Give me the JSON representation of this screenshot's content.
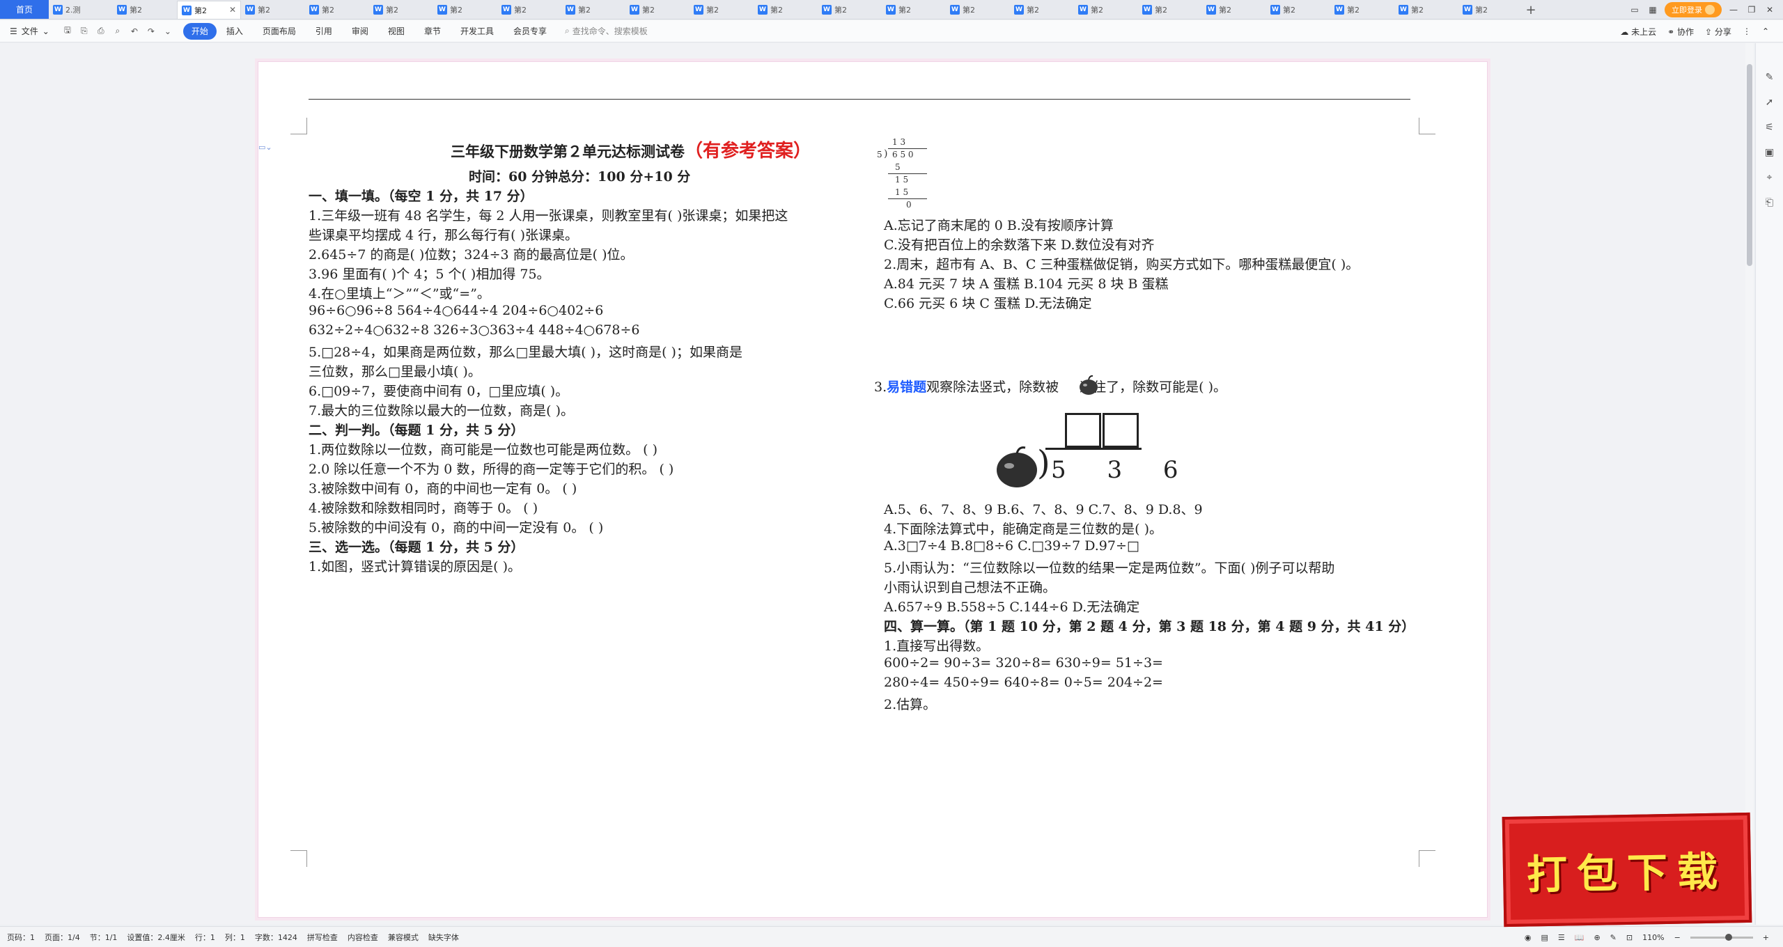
{
  "tabs": {
    "home": "首页",
    "docs": [
      "2.测",
      "第2",
      "第2",
      "第2",
      "第2",
      "第2",
      "第2",
      "第2",
      "第2",
      "第2",
      "第2",
      "第2",
      "第2",
      "第2",
      "第2",
      "第2",
      "第2",
      "第2",
      "第2",
      "第2",
      "第2",
      "第2",
      "第2"
    ],
    "active_index": 2,
    "login": "立即登录",
    "plus": "+"
  },
  "toolbar": {
    "file": "文件",
    "menus": [
      "开始",
      "插入",
      "页面布局",
      "引用",
      "审阅",
      "视图",
      "章节",
      "开发工具",
      "会员专享"
    ],
    "search_placeholder": "查找命令、搜索模板",
    "cloud": "未上云",
    "collab": "协作",
    "share": "分享"
  },
  "document": {
    "title_main": "三年级下册数学第２单元达标测试卷",
    "title_red": "（有参考答案）",
    "subtitle": "时间：60 分钟总分：100 分+10 分",
    "left_lines": [
      "一、填一填。（每空 1 分，共 17 分）",
      "1.三年级一班有 48 名学生，每 2 人用一张课桌，则教室里有(          )张课桌；如果把这",
      "些课桌平均摆成 4 行，那么每行有(          )张课桌。",
      "2.645÷7 的商是(          )位数；324÷3 商的最高位是(            )位。",
      "3.96 里面有(          )个 4；5 个(          )相加得 75。",
      "4.在○里填上“＞”“＜”或“=”。",
      "96÷6○96÷8                   564÷4○644÷4                  204÷6○402÷6",
      "632÷2÷4○632÷8             326÷3○363÷4                  448÷4○678÷6",
      "5.□28÷4，如果商是两位数，那么□里最大填(          )，这时商是(        )；如果商是",
      "三位数，那么□里最小填(          )。",
      "6.□09÷7，要使商中间有 0，□里应填(          )。",
      "7.最大的三位数除以最大的一位数，商是(            )。",
      "二、判一判。（每题 1 分，共 5 分）",
      "1.两位数除以一位数，商可能是一位数也可能是两位数。            (        )",
      "2.0 除以任意一个不为 0 数，所得的商一定等于它们的积。          (        )",
      "3.被除数中间有 0，商的中间也一定有 0。                                   (        )",
      "4.被除数和除数相同时，商等于 0。                                             (        )",
      "5.被除数的中间没有 0，商的中间一定没有 0。                             (        )",
      "三、选一选。（每题 1 分，共 5 分）",
      "1.如图，竖式计算错误的原因是(          )。"
    ],
    "long_division": {
      "quotient": "1 3",
      "divisor": "5",
      "dividend": "6 5 0",
      "step1": "5",
      "step2": "1 5",
      "step3": "1 5",
      "remainder": "0"
    },
    "right_lines_a": [
      "A.忘记了商末尾的 0                    B.没有按顺序计算",
      "C.没有把百位上的余数落下来        D.数位没有对齐",
      "2.周末，超市有 A、B、C 三种蛋糕做促销，购买方式如下。哪种蛋糕最便宜(        )。",
      "A.84 元买 7 块 A 蛋糕                  B.104 元买 8 块 B 蛋糕",
      "C.66 元买 6 块 C 蛋糕                  D.无法确定"
    ],
    "q3_prefix": "3.",
    "q3_tag": "易错题",
    "q3_text": "观察除法竖式，除数被",
    "q3_text2": "遮住了，除数可能是(        )。",
    "apple_division": "5  3  6",
    "right_lines_b": [
      "A.5、6、7、8、9            B.6、7、8、9        C.7、8、9            D.8、9",
      "4.下面除法算式中，能确定商是三位数的是(          )。",
      "A.3□7÷4               B.8□8÷6               C.□39÷7          D.97÷□",
      "5.小雨认为：“三位数除以一位数的结果一定是两位数”。下面(          )例子可以帮助",
      "小雨认识到自己想法不正确。",
      "A.657÷9               B.558÷5            C.144÷6             D.无法确定",
      "四、算一算。（第 1 题 10 分，第 2 题 4 分，第 3 题 18 分，第 4 题 9 分，共 41 分）",
      "1.直接写出得数。",
      "600÷2=           90÷3=        320÷8=        630÷9=            51÷3=",
      "280÷4=           450÷9=          640÷8=          0÷5=            204÷2=",
      "2.估算。"
    ]
  },
  "status": {
    "items": [
      "页码：1",
      "页面：1/4",
      "节：1/1",
      "设置值：2.4厘米",
      "行：1",
      "列：1",
      "字数：1424",
      "拼写检查",
      "内容检查",
      "兼容模式",
      "缺失字体"
    ],
    "zoom": "110%"
  },
  "promo": "打包下载"
}
